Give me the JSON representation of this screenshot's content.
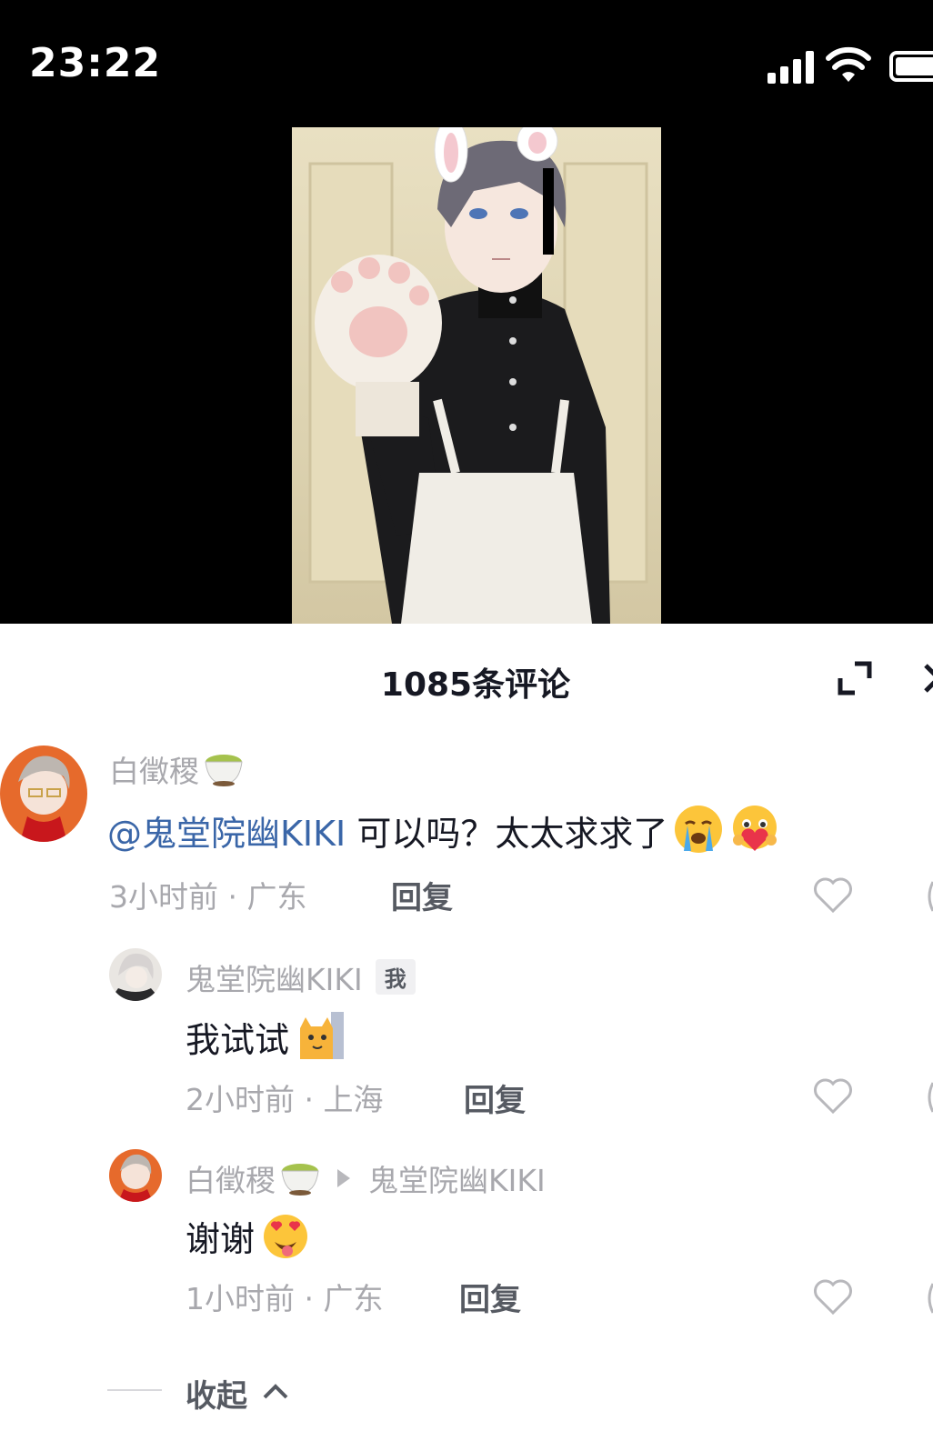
{
  "status_bar": {
    "time": "23:22"
  },
  "video": {
    "description_icon": "video-thumbnail"
  },
  "comments_panel": {
    "title": "1085条评论",
    "expand_icon": "expand-icon",
    "close_icon": "close-icon"
  },
  "comments": [
    {
      "username": "白徵稷",
      "username_emoji": "tea-icon",
      "mention": "@鬼堂院幽KIKI",
      "text": " 可以吗？太太求求了",
      "emojis": [
        "crying-emoji",
        "heart-hug-emoji"
      ],
      "time": "3小时前",
      "location": "广东",
      "meta_sep": " · ",
      "reply_label": "回复"
    },
    {
      "username": "鬼堂院幽KIKI",
      "badge": "我",
      "text": "我试试",
      "emojis": [
        "peeking-cat-emoji"
      ],
      "time": "2小时前",
      "location": "上海",
      "meta_sep": " · ",
      "reply_label": "回复"
    },
    {
      "username": "白徵稷",
      "username_emoji": "tea-icon",
      "reply_to": "鬼堂院幽KIKI",
      "text": "谢谢",
      "emojis": [
        "heart-eyes-tongue-emoji"
      ],
      "time": "1小时前",
      "location": "广东",
      "meta_sep": " · ",
      "reply_label": "回复"
    }
  ],
  "collapse": {
    "label": "收起"
  },
  "colors": {
    "mention": "#3a66a8",
    "muted_text": "#a8a8ad",
    "primary_text": "#161823"
  }
}
